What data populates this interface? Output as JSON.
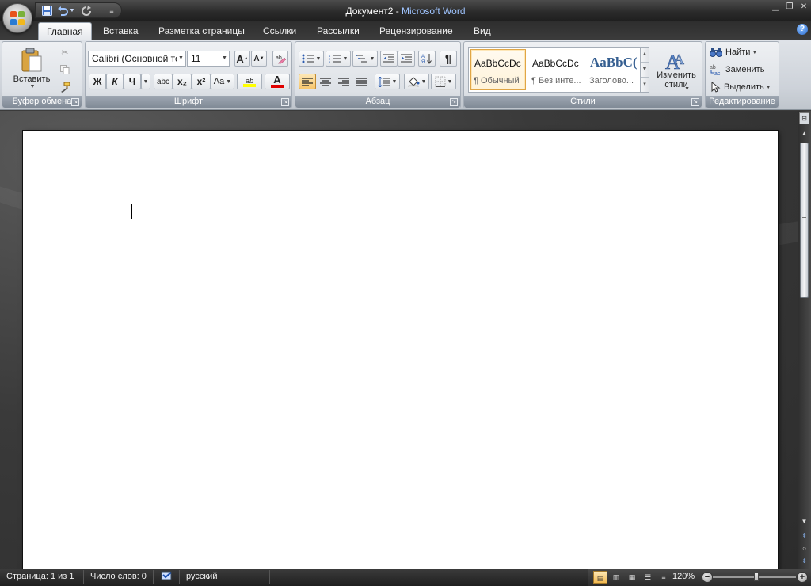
{
  "title": {
    "doc": "Документ2",
    "sep": " - ",
    "app": "Microsoft Word"
  },
  "qat": {
    "save_icon": "save-icon",
    "undo_icon": "undo-icon",
    "redo_icon": "redo-icon",
    "customize_icon": "customize-icon"
  },
  "tabs": [
    "Главная",
    "Вставка",
    "Разметка страницы",
    "Ссылки",
    "Рассылки",
    "Рецензирование",
    "Вид"
  ],
  "groups": {
    "clipboard": {
      "label": "Буфер обмена",
      "paste": "Вставить"
    },
    "font": {
      "label": "Шрифт",
      "font_name": "Calibri (Основной текст)",
      "font_size": "11",
      "grow": "A",
      "shrink": "A",
      "bold": "Ж",
      "italic": "К",
      "underline": "Ч",
      "strike": "abc",
      "sub": "x₂",
      "sup": "x²",
      "case": "Aa",
      "highlight": "ab",
      "color": "A"
    },
    "paragraph": {
      "label": "Абзац",
      "pilcrow": "¶"
    },
    "styles": {
      "label": "Стили",
      "items": [
        {
          "sample": "AaBbCcDc",
          "name": "¶ Обычный"
        },
        {
          "sample": "AaBbCcDc",
          "name": "¶ Без инте..."
        },
        {
          "sample": "AaBbC(",
          "name": "Заголово..."
        }
      ],
      "change": "Изменить стили"
    },
    "editing": {
      "label": "Редактирование",
      "find": "Найти",
      "replace": "Заменить",
      "select": "Выделить"
    }
  },
  "status": {
    "page": "Страница: 1 из 1",
    "words": "Число слов: 0",
    "language": "русский",
    "zoom": "120%",
    "zoom_level": 1.2
  },
  "colors": {
    "highlight": "#ffff00",
    "font_color": "#e00000",
    "heading_style": "#365f91",
    "accent": "#f7c66c"
  }
}
